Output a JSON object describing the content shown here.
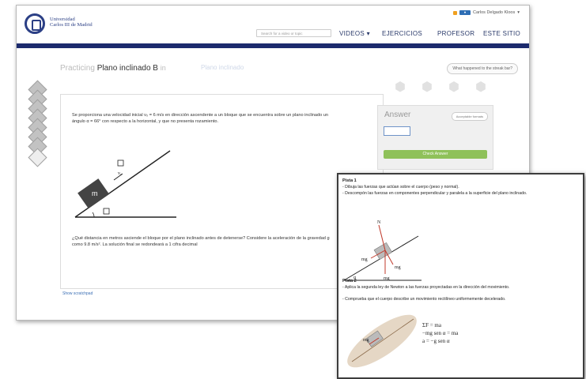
{
  "header": {
    "university_line1": "Universidad",
    "university_line2": "Carlos III de Madrid",
    "user_name": "Carlos Delgado Kloos",
    "search_placeholder": "Search for a video or topic",
    "nav": [
      "VIDEOS",
      "EJERCICIOS",
      "PROFESOR",
      "ESTE SITIO"
    ],
    "videos_caret": "▾",
    "user_caret": "▾"
  },
  "exercise": {
    "practicing_label": "Practicing",
    "title": "Plano inclinado B",
    "in_label": "in",
    "breadcrumb": "Plano inclinado",
    "what_happened": "What happened to the streak bar?",
    "problem_part1": "Se proporciona una velocidad inicial v₀ = 6 m/s en dirección ascendente a un bloque que se encuentra sobre un plano inclinado un ángulo α = 66° con respecto a la horizontal, y que no presenta rozamiento.",
    "problem_part2": "¿Qué distancia en metros asciende el bloque por el plano inclinado antes de detenerse? Considere la aceleración de la gravedad g como 9.8 m/s². La solución final se redondeará a 1 cifra decimal",
    "show_scratchpad": "Show scratchpad",
    "block_label": "m",
    "velocity_label": "v₀"
  },
  "answer": {
    "label": "Answer",
    "formats_button": "Acceptable formats",
    "check_button": "Check Answer",
    "value": ""
  },
  "hints": {
    "hint1_title": "Pista 1",
    "hint1_lines": [
      "- Dibuja las fuerzas que actúan sobre el cuerpo (peso y normal).",
      "- Descompón las fuerzas en componentes perpendicular y paralela a la superficie del plano inclinado."
    ],
    "hint2_title": "Pista 2",
    "hint2_lines": [
      "- Aplica la segunda ley de Newton a las fuerzas proyectadas en la dirección del movimiento.",
      "- Comprueba que el cuerpo describe un movimiento rectilíneo uniformemente decelerado."
    ],
    "diagram1_labels": {
      "normal": "N",
      "parallel": "mg",
      "perp": "mg",
      "weight": "mg",
      "angle": "α"
    },
    "diagram2_label": "mg",
    "equations": [
      "ΣF = ma",
      "−mg sen α = ma",
      "a = −g sen α"
    ]
  },
  "colors": {
    "navbar": "#1c2a6d",
    "brand": "#2b3f85",
    "check_button": "#8fc15a",
    "block": "#444444"
  }
}
